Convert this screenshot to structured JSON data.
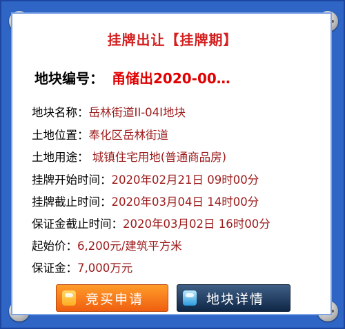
{
  "header": {
    "title": "挂牌出让【挂牌期】"
  },
  "parcel": {
    "code_label": "地块编号：",
    "code_value": "甬储出2020-00…"
  },
  "fields": [
    {
      "label": "地块名称：",
      "value": "岳林街道II-04I地块"
    },
    {
      "label": "土地位置：",
      "value": "奉化区岳林街道"
    },
    {
      "label": "土地用途：",
      "value": " 城镇住宅用地(普通商品房)"
    },
    {
      "label": "挂牌开始时间：",
      "value": "2020年02月21日 09时00分"
    },
    {
      "label": "挂牌截止时间：",
      "value": "2020年03月04日 14时00分"
    },
    {
      "label": "保证金截止时间：",
      "value": "2020年03月02日 16时00分"
    },
    {
      "label": "起始价：",
      "value": "6,200元/建筑平方米"
    },
    {
      "label": "保证金：",
      "value": "7,000万元"
    }
  ],
  "buttons": {
    "apply": "竞买申请",
    "detail": "地块详情"
  },
  "colors": {
    "frame": "#2f66c6",
    "title": "#d42020",
    "value": "#9c1a1a",
    "apply": "#f27a18",
    "detail": "#15304f"
  },
  "icons": [
    "screw-icon",
    "apply-icon",
    "detail-icon"
  ]
}
